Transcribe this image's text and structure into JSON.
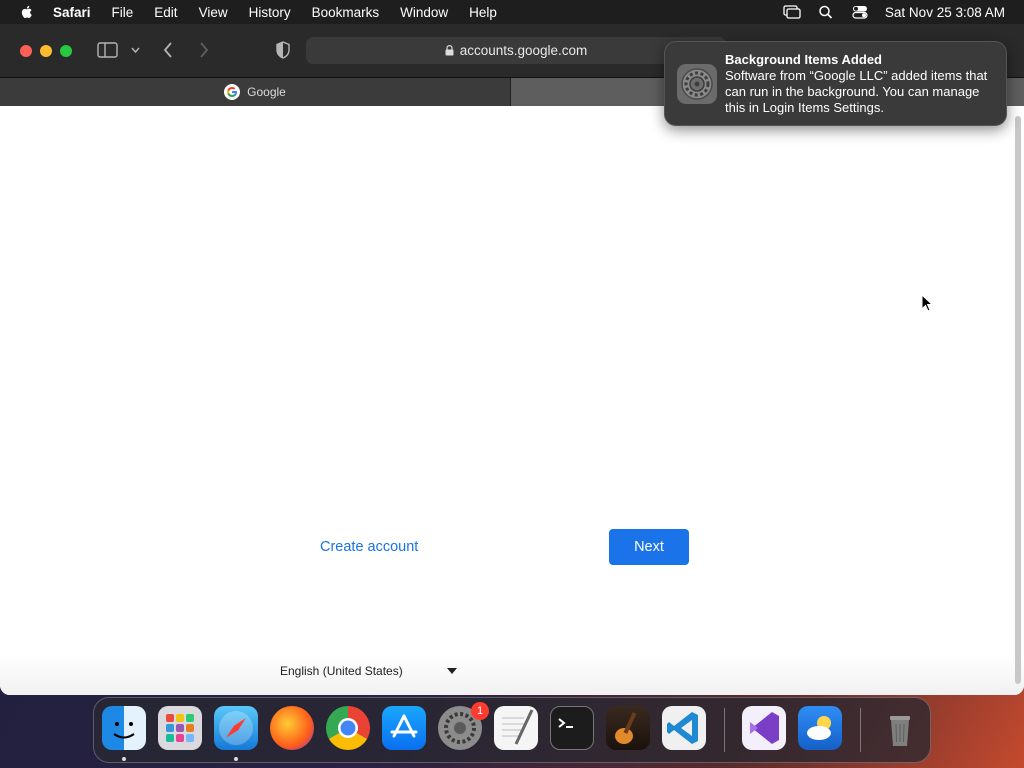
{
  "menubar": {
    "app": "Safari",
    "items": [
      "File",
      "Edit",
      "View",
      "History",
      "Bookmarks",
      "Window",
      "Help"
    ],
    "clock": "Sat Nov 25  3:08 AM"
  },
  "toolbar": {
    "url": "accounts.google.com"
  },
  "tabs": [
    {
      "label": "Google",
      "active": true
    },
    {
      "label": "",
      "active": false
    }
  ],
  "page": {
    "create_account": "Create account",
    "next": "Next",
    "language": "English (United States)"
  },
  "notification": {
    "title": "Background Items Added",
    "body": "Software from “Google LLC” added items that can run in the background. You can manage this in Login Items Settings."
  },
  "dock": {
    "apps": [
      "finder-icon",
      "launchpad-icon",
      "safari-icon",
      "firefox-icon",
      "chrome-icon",
      "app-store-icon",
      "system-settings-icon",
      "textedit-icon",
      "terminal-icon",
      "garageband-icon",
      "vscode-icon",
      "visual-studio-icon",
      "weather-icon",
      "trash-icon"
    ],
    "settings_badge": "1"
  },
  "colors": {
    "accent": "#1a73e8",
    "menubar": "#1e1e1e",
    "toolbar": "#2a2a2a"
  }
}
